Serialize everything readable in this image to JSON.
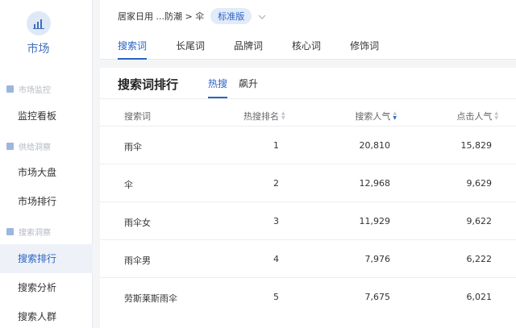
{
  "app": {
    "logo_label": "市场"
  },
  "sidebar": {
    "sections": [
      {
        "label": "市场监控",
        "items": [
          {
            "label": "监控看板",
            "active": false
          }
        ]
      },
      {
        "label": "供给洞察",
        "items": [
          {
            "label": "市场大盘",
            "active": false
          },
          {
            "label": "市场排行",
            "active": false
          }
        ]
      },
      {
        "label": "搜索洞察",
        "items": [
          {
            "label": "搜索排行",
            "active": true
          },
          {
            "label": "搜索分析",
            "active": false
          },
          {
            "label": "搜索人群",
            "active": false
          }
        ]
      }
    ]
  },
  "breadcrumb": {
    "path": "居家日用 ...防潮 > 伞",
    "badge": "标准版"
  },
  "tabs": [
    {
      "label": "搜索词",
      "active": true
    },
    {
      "label": "长尾词",
      "active": false
    },
    {
      "label": "品牌词",
      "active": false
    },
    {
      "label": "核心词",
      "active": false
    },
    {
      "label": "修饰词",
      "active": false
    }
  ],
  "card": {
    "title": "搜索词排行",
    "subtabs": [
      {
        "label": "热搜",
        "active": true
      },
      {
        "label": "飙升",
        "active": false
      }
    ]
  },
  "table": {
    "columns": {
      "word": "搜索词",
      "rank": "热搜排名",
      "popularity": "搜索人气",
      "clicks": "点击人气"
    },
    "rows": [
      {
        "word": "雨伞",
        "rank": "1",
        "popularity": "20,810",
        "clicks": "15,829"
      },
      {
        "word": "伞",
        "rank": "2",
        "popularity": "12,968",
        "clicks": "9,629"
      },
      {
        "word": "雨伞女",
        "rank": "3",
        "popularity": "11,929",
        "clicks": "9,622"
      },
      {
        "word": "雨伞男",
        "rank": "4",
        "popularity": "7,976",
        "clicks": "6,222"
      },
      {
        "word": "劳斯莱斯雨伞",
        "rank": "5",
        "popularity": "7,675",
        "clicks": "6,021"
      }
    ]
  },
  "colors": {
    "accent": "#2b62c4",
    "background": "#f4f5f7",
    "active_bg": "#eef2f8"
  }
}
